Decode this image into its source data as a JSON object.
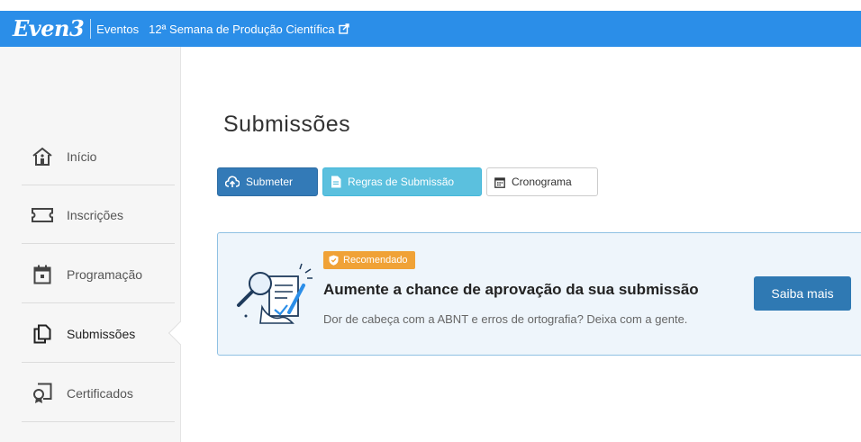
{
  "header": {
    "logo": "Even3",
    "events_link": "Eventos",
    "event_name": "12ª Semana de Produção Científica",
    "bg_color": "#2b8ee8"
  },
  "sidebar": {
    "items": [
      {
        "label": "Início",
        "icon": "home-icon"
      },
      {
        "label": "Inscrições",
        "icon": "ticket-icon"
      },
      {
        "label": "Programação",
        "icon": "calendar-icon"
      },
      {
        "label": "Submissões",
        "icon": "documents-icon",
        "active": true
      },
      {
        "label": "Certificados",
        "icon": "certificate-icon"
      }
    ]
  },
  "main": {
    "title": "Submissões",
    "buttons": {
      "submit_label": "Submeter",
      "rules_label": "Regras de Submissão",
      "schedule_label": "Cronograma"
    },
    "promo": {
      "badge": "Recomendado",
      "title": "Aumente a chance de aprovação da sua submissão",
      "subtitle": "Dor de cabeça com a ABNT e erros de ortografia? Deixa com a gente.",
      "cta_label": "Saiba mais"
    }
  },
  "colors": {
    "primary": "#337ab7",
    "info": "#5bc0de",
    "badge": "#f0a236",
    "promo_bg": "#eef5fb"
  }
}
